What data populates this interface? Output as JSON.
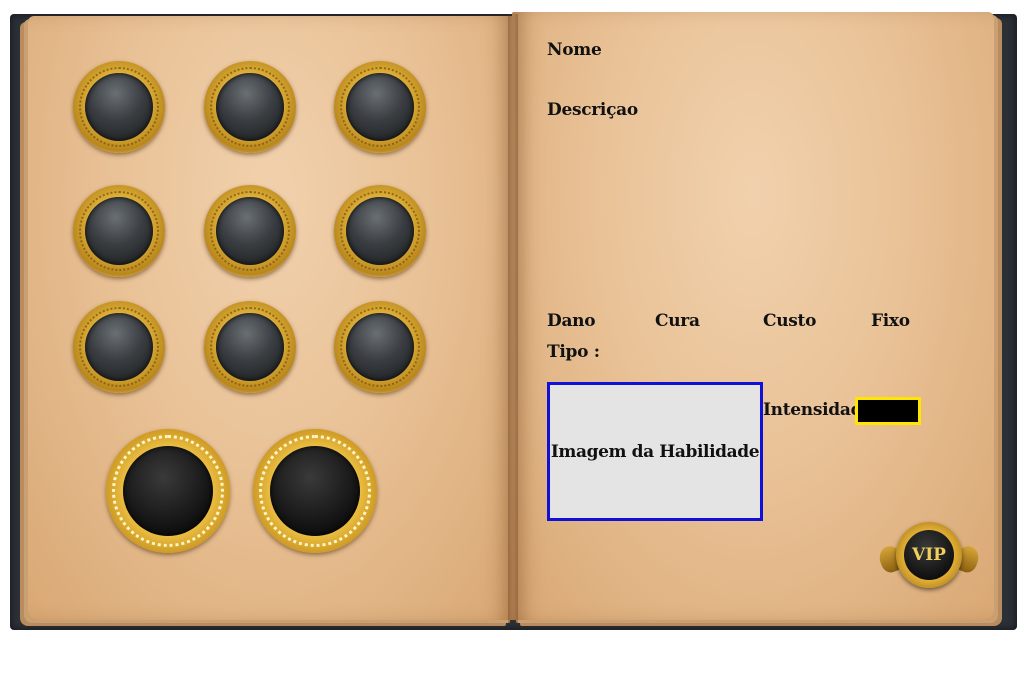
{
  "detail_panel": {
    "name_label": "Nome",
    "description_label": "Descriçao",
    "stats": {
      "damage_label": "Dano",
      "heal_label": "Cura",
      "cost_label": "Custo",
      "fixed_label": "Fixo"
    },
    "type_label": "Tipo :",
    "skill_image_placeholder": "Imagem da Habilidade",
    "intensity_label": "Intensidade",
    "intensity_value": ""
  },
  "vip_badge": {
    "label": "VIP"
  },
  "colors": {
    "image_frame_border": "#1010d8",
    "image_frame_fill": "#e4e4e4",
    "intensity_box_border": "#ffe600",
    "intensity_box_fill": "#000000",
    "slot_gold": "#e3b53c"
  }
}
